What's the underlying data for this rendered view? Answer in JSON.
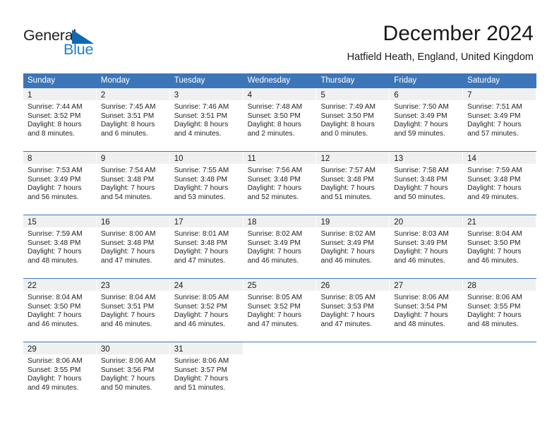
{
  "brand": {
    "name_part1": "General",
    "name_part2": "Blue",
    "triangle_color": "#1268b3",
    "blue_color": "#1d7fd0"
  },
  "header": {
    "title": "December 2024",
    "location": "Hatfield Heath, England, United Kingdom"
  },
  "theme": {
    "header_bar": "#3d76b8",
    "daynum_band": "#f0f0f0",
    "text": "#242424"
  },
  "calendar": {
    "weekday_headers": [
      "Sunday",
      "Monday",
      "Tuesday",
      "Wednesday",
      "Thursday",
      "Friday",
      "Saturday"
    ],
    "weeks": [
      [
        {
          "day": "1",
          "sunrise": "Sunrise: 7:44 AM",
          "sunset": "Sunset: 3:52 PM",
          "daylight1": "Daylight: 8 hours",
          "daylight2": "and 8 minutes."
        },
        {
          "day": "2",
          "sunrise": "Sunrise: 7:45 AM",
          "sunset": "Sunset: 3:51 PM",
          "daylight1": "Daylight: 8 hours",
          "daylight2": "and 6 minutes."
        },
        {
          "day": "3",
          "sunrise": "Sunrise: 7:46 AM",
          "sunset": "Sunset: 3:51 PM",
          "daylight1": "Daylight: 8 hours",
          "daylight2": "and 4 minutes."
        },
        {
          "day": "4",
          "sunrise": "Sunrise: 7:48 AM",
          "sunset": "Sunset: 3:50 PM",
          "daylight1": "Daylight: 8 hours",
          "daylight2": "and 2 minutes."
        },
        {
          "day": "5",
          "sunrise": "Sunrise: 7:49 AM",
          "sunset": "Sunset: 3:50 PM",
          "daylight1": "Daylight: 8 hours",
          "daylight2": "and 0 minutes."
        },
        {
          "day": "6",
          "sunrise": "Sunrise: 7:50 AM",
          "sunset": "Sunset: 3:49 PM",
          "daylight1": "Daylight: 7 hours",
          "daylight2": "and 59 minutes."
        },
        {
          "day": "7",
          "sunrise": "Sunrise: 7:51 AM",
          "sunset": "Sunset: 3:49 PM",
          "daylight1": "Daylight: 7 hours",
          "daylight2": "and 57 minutes."
        }
      ],
      [
        {
          "day": "8",
          "sunrise": "Sunrise: 7:53 AM",
          "sunset": "Sunset: 3:49 PM",
          "daylight1": "Daylight: 7 hours",
          "daylight2": "and 56 minutes."
        },
        {
          "day": "9",
          "sunrise": "Sunrise: 7:54 AM",
          "sunset": "Sunset: 3:48 PM",
          "daylight1": "Daylight: 7 hours",
          "daylight2": "and 54 minutes."
        },
        {
          "day": "10",
          "sunrise": "Sunrise: 7:55 AM",
          "sunset": "Sunset: 3:48 PM",
          "daylight1": "Daylight: 7 hours",
          "daylight2": "and 53 minutes."
        },
        {
          "day": "11",
          "sunrise": "Sunrise: 7:56 AM",
          "sunset": "Sunset: 3:48 PM",
          "daylight1": "Daylight: 7 hours",
          "daylight2": "and 52 minutes."
        },
        {
          "day": "12",
          "sunrise": "Sunrise: 7:57 AM",
          "sunset": "Sunset: 3:48 PM",
          "daylight1": "Daylight: 7 hours",
          "daylight2": "and 51 minutes."
        },
        {
          "day": "13",
          "sunrise": "Sunrise: 7:58 AM",
          "sunset": "Sunset: 3:48 PM",
          "daylight1": "Daylight: 7 hours",
          "daylight2": "and 50 minutes."
        },
        {
          "day": "14",
          "sunrise": "Sunrise: 7:59 AM",
          "sunset": "Sunset: 3:48 PM",
          "daylight1": "Daylight: 7 hours",
          "daylight2": "and 49 minutes."
        }
      ],
      [
        {
          "day": "15",
          "sunrise": "Sunrise: 7:59 AM",
          "sunset": "Sunset: 3:48 PM",
          "daylight1": "Daylight: 7 hours",
          "daylight2": "and 48 minutes."
        },
        {
          "day": "16",
          "sunrise": "Sunrise: 8:00 AM",
          "sunset": "Sunset: 3:48 PM",
          "daylight1": "Daylight: 7 hours",
          "daylight2": "and 47 minutes."
        },
        {
          "day": "17",
          "sunrise": "Sunrise: 8:01 AM",
          "sunset": "Sunset: 3:48 PM",
          "daylight1": "Daylight: 7 hours",
          "daylight2": "and 47 minutes."
        },
        {
          "day": "18",
          "sunrise": "Sunrise: 8:02 AM",
          "sunset": "Sunset: 3:49 PM",
          "daylight1": "Daylight: 7 hours",
          "daylight2": "and 46 minutes."
        },
        {
          "day": "19",
          "sunrise": "Sunrise: 8:02 AM",
          "sunset": "Sunset: 3:49 PM",
          "daylight1": "Daylight: 7 hours",
          "daylight2": "and 46 minutes."
        },
        {
          "day": "20",
          "sunrise": "Sunrise: 8:03 AM",
          "sunset": "Sunset: 3:49 PM",
          "daylight1": "Daylight: 7 hours",
          "daylight2": "and 46 minutes."
        },
        {
          "day": "21",
          "sunrise": "Sunrise: 8:04 AM",
          "sunset": "Sunset: 3:50 PM",
          "daylight1": "Daylight: 7 hours",
          "daylight2": "and 46 minutes."
        }
      ],
      [
        {
          "day": "22",
          "sunrise": "Sunrise: 8:04 AM",
          "sunset": "Sunset: 3:50 PM",
          "daylight1": "Daylight: 7 hours",
          "daylight2": "and 46 minutes."
        },
        {
          "day": "23",
          "sunrise": "Sunrise: 8:04 AM",
          "sunset": "Sunset: 3:51 PM",
          "daylight1": "Daylight: 7 hours",
          "daylight2": "and 46 minutes."
        },
        {
          "day": "24",
          "sunrise": "Sunrise: 8:05 AM",
          "sunset": "Sunset: 3:52 PM",
          "daylight1": "Daylight: 7 hours",
          "daylight2": "and 46 minutes."
        },
        {
          "day": "25",
          "sunrise": "Sunrise: 8:05 AM",
          "sunset": "Sunset: 3:52 PM",
          "daylight1": "Daylight: 7 hours",
          "daylight2": "and 47 minutes."
        },
        {
          "day": "26",
          "sunrise": "Sunrise: 8:05 AM",
          "sunset": "Sunset: 3:53 PM",
          "daylight1": "Daylight: 7 hours",
          "daylight2": "and 47 minutes."
        },
        {
          "day": "27",
          "sunrise": "Sunrise: 8:06 AM",
          "sunset": "Sunset: 3:54 PM",
          "daylight1": "Daylight: 7 hours",
          "daylight2": "and 48 minutes."
        },
        {
          "day": "28",
          "sunrise": "Sunrise: 8:06 AM",
          "sunset": "Sunset: 3:55 PM",
          "daylight1": "Daylight: 7 hours",
          "daylight2": "and 48 minutes."
        }
      ],
      [
        {
          "day": "29",
          "sunrise": "Sunrise: 8:06 AM",
          "sunset": "Sunset: 3:55 PM",
          "daylight1": "Daylight: 7 hours",
          "daylight2": "and 49 minutes."
        },
        {
          "day": "30",
          "sunrise": "Sunrise: 8:06 AM",
          "sunset": "Sunset: 3:56 PM",
          "daylight1": "Daylight: 7 hours",
          "daylight2": "and 50 minutes."
        },
        {
          "day": "31",
          "sunrise": "Sunrise: 8:06 AM",
          "sunset": "Sunset: 3:57 PM",
          "daylight1": "Daylight: 7 hours",
          "daylight2": "and 51 minutes."
        },
        {
          "day": "",
          "sunrise": "",
          "sunset": "",
          "daylight1": "",
          "daylight2": ""
        },
        {
          "day": "",
          "sunrise": "",
          "sunset": "",
          "daylight1": "",
          "daylight2": ""
        },
        {
          "day": "",
          "sunrise": "",
          "sunset": "",
          "daylight1": "",
          "daylight2": ""
        },
        {
          "day": "",
          "sunrise": "",
          "sunset": "",
          "daylight1": "",
          "daylight2": ""
        }
      ]
    ]
  }
}
